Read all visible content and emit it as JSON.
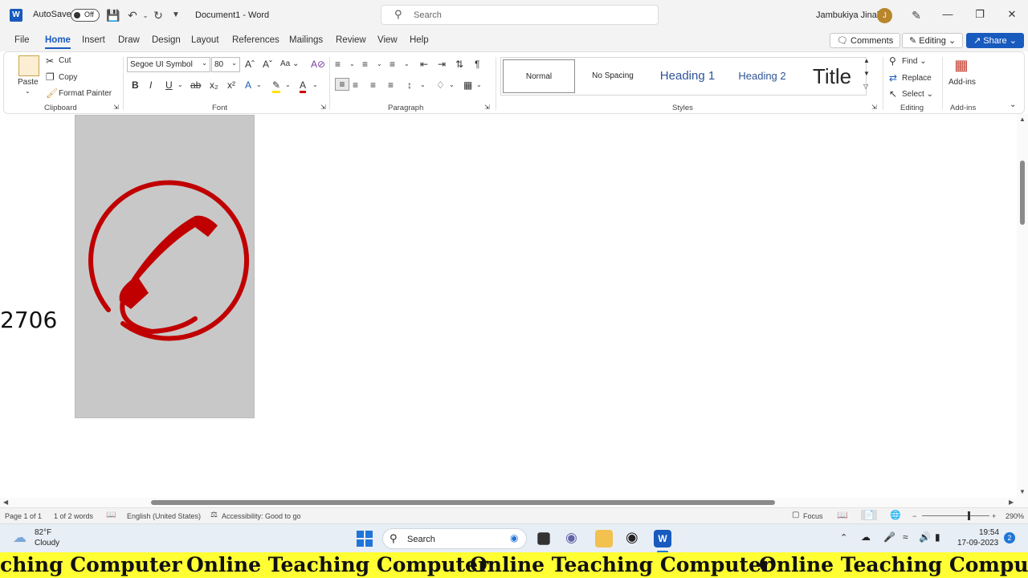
{
  "titlebar": {
    "app_logo": "W",
    "autosave_label": "AutoSave",
    "autosave_state": "Off",
    "document_title": "Document1  -  Word",
    "search_placeholder": "Search",
    "user_name": "Jambukiya Jinal",
    "user_initial": "J"
  },
  "tabs": [
    "File",
    "Home",
    "Insert",
    "Draw",
    "Design",
    "Layout",
    "References",
    "Mailings",
    "Review",
    "View",
    "Help"
  ],
  "active_tab": "Home",
  "ribbon_buttons": {
    "comments": "Comments",
    "editing": "Editing",
    "share": "Share"
  },
  "clipboard": {
    "paste": "Paste",
    "cut": "Cut",
    "copy": "Copy",
    "format_painter": "Format Painter",
    "label": "Clipboard"
  },
  "font": {
    "name": "Segoe UI Symbol",
    "size": "80",
    "label": "Font",
    "change_case": "Aa"
  },
  "paragraph": {
    "label": "Paragraph"
  },
  "styles": {
    "items": [
      "Normal",
      "No Spacing",
      "Heading 1",
      "Heading 2",
      "Title"
    ],
    "label": "Styles"
  },
  "editing": {
    "find": "Find",
    "replace": "Replace",
    "select": "Select",
    "label": "Editing"
  },
  "addins": {
    "button": "Add-ins",
    "label": "Add-ins"
  },
  "document": {
    "text": "2706"
  },
  "statusbar": {
    "page": "Page 1 of 1",
    "words": "1 of 2 words",
    "language": "English (United States)",
    "accessibility": "Accessibility: Good to go",
    "focus": "Focus",
    "zoom": "290%"
  },
  "taskbar": {
    "weather_temp": "82°F",
    "weather_desc": "Cloudy",
    "search": "Search",
    "time": "19:54",
    "date": "17-09-2023",
    "notifications": "2"
  },
  "banner": {
    "text": "Online Teaching Computer",
    "partial": "ching Computer"
  },
  "colors": {
    "accent": "#185abd",
    "phone_red": "#c00000",
    "banner": "#ffff33"
  }
}
